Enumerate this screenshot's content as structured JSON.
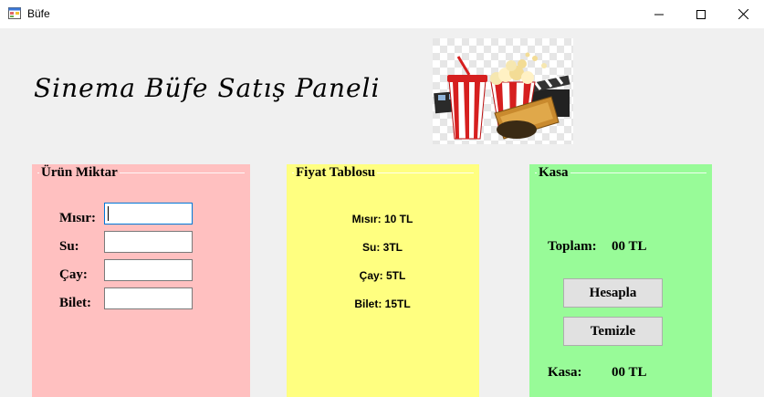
{
  "window": {
    "title": "Büfe"
  },
  "heading": "Sinema Büfe Satış Paneli",
  "urun_miktar": {
    "title": "Ürün Miktar",
    "fields": [
      {
        "label": "Mısır:",
        "value": ""
      },
      {
        "label": "Su:",
        "value": ""
      },
      {
        "label": "Çay:",
        "value": ""
      },
      {
        "label": "Bilet:",
        "value": ""
      }
    ]
  },
  "fiyat_tablosu": {
    "title": "Fiyat Tablosu",
    "items": [
      "Mısır: 10 TL",
      "Su: 3TL",
      "Çay: 5TL",
      "Bilet: 15TL"
    ]
  },
  "kasa": {
    "title": "Kasa",
    "toplam_label": "Toplam:",
    "toplam_value": "00 TL",
    "hesapla_button": "Hesapla",
    "temizle_button": "Temizle",
    "kasa_label": "Kasa:",
    "kasa_value": "00 TL"
  },
  "colors": {
    "urun_bg": "#ffc0c0",
    "fiyat_bg": "#ffff80",
    "kasa_bg": "#98fb98"
  }
}
